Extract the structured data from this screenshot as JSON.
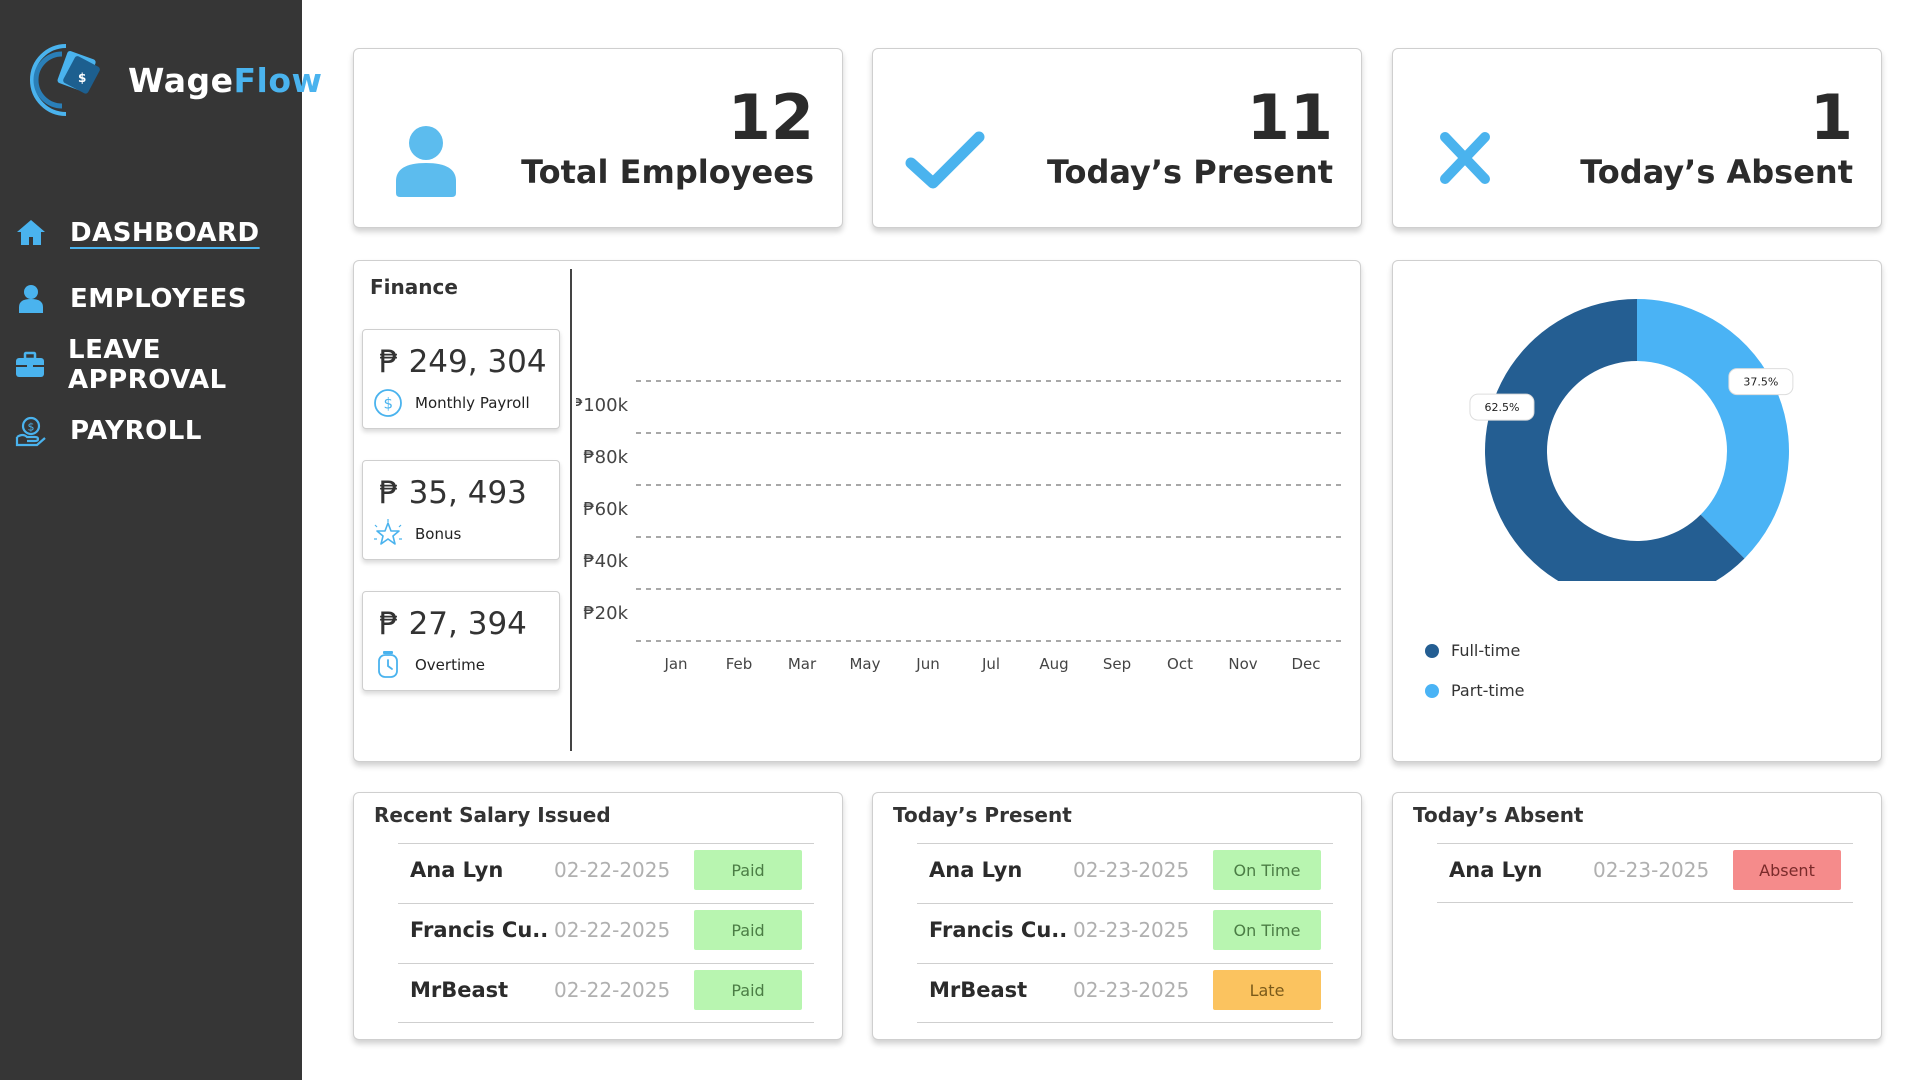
{
  "app": {
    "brand_prefix": "Wage",
    "brand_suffix": "Flow"
  },
  "sidebar": {
    "items": [
      {
        "label": "DASHBOARD",
        "icon": "home-icon",
        "active": true
      },
      {
        "label": "EMPLOYEES",
        "icon": "user-icon",
        "active": false
      },
      {
        "label": "LEAVE APPROVAL",
        "icon": "briefcase-icon",
        "active": false
      },
      {
        "label": "PAYROLL",
        "icon": "payroll-hand-icon",
        "active": false
      }
    ]
  },
  "stats": [
    {
      "value": "12",
      "label": "Total Employees",
      "icon": "user-icon"
    },
    {
      "value": "11",
      "label": "Today’s Present",
      "icon": "check-icon"
    },
    {
      "value": "1",
      "label": "Today’s Absent",
      "icon": "x-icon"
    }
  ],
  "finance": {
    "title": "Finance",
    "cards": [
      {
        "amount": "₱ 249, 304",
        "label": "Monthly Payroll",
        "icon": "dollar-circle-icon"
      },
      {
        "amount": "₱ 35, 493",
        "label": "Bonus",
        "icon": "star-icon"
      },
      {
        "amount": "₱ 27, 394",
        "label": "Overtime",
        "icon": "stopwatch-icon"
      }
    ]
  },
  "chart_data": [
    {
      "type": "line",
      "title": "",
      "xlabel": "",
      "ylabel": "",
      "categories": [
        "Jan",
        "Feb",
        "Mar",
        "May",
        "Jun",
        "Jul",
        "Aug",
        "Sep",
        "Oct",
        "Nov",
        "Dec"
      ],
      "y_ticks": [
        "₱100k",
        "₱80k",
        "₱60k",
        "₱40k",
        "₱20k"
      ],
      "series": [],
      "grid": true
    },
    {
      "type": "pie",
      "variant": "donut",
      "slices": [
        {
          "name": "Full-time",
          "value": 62.5,
          "label": "62.5%",
          "color": "#245e92"
        },
        {
          "name": "Part-time",
          "value": 37.5,
          "label": "37.5%",
          "color": "#4ab3f5"
        }
      ],
      "legend": "bottom-left"
    }
  ],
  "tables": [
    {
      "title": "Recent Salary Issued",
      "rows": [
        {
          "name": "Ana Lyn",
          "date": "02-22-2025",
          "status": "Paid",
          "status_color": "#b8f5b0",
          "text_color": "#4b7d45"
        },
        {
          "name": "Francis Cu..",
          "date": "02-22-2025",
          "status": "Paid",
          "status_color": "#b8f5b0",
          "text_color": "#4b7d45"
        },
        {
          "name": "MrBeast",
          "date": "02-22-2025",
          "status": "Paid",
          "status_color": "#b8f5b0",
          "text_color": "#4b7d45"
        }
      ]
    },
    {
      "title": "Today’s Present",
      "rows": [
        {
          "name": "Ana Lyn",
          "date": "02-23-2025",
          "status": "On Time",
          "status_color": "#b8f5b0",
          "text_color": "#4b7d45"
        },
        {
          "name": "Francis Cu..",
          "date": "02-23-2025",
          "status": "On Time",
          "status_color": "#b8f5b0",
          "text_color": "#4b7d45"
        },
        {
          "name": "MrBeast",
          "date": "02-23-2025",
          "status": "Late",
          "status_color": "#fbc35f",
          "text_color": "#7a5a1a"
        }
      ]
    },
    {
      "title": "Today’s Absent",
      "rows": [
        {
          "name": "Ana Lyn",
          "date": "02-23-2025",
          "status": "Absent",
          "status_color": "#f58b8b",
          "text_color": "#7a2a2a"
        }
      ]
    }
  ],
  "colors": {
    "sidebar_bg": "#363636",
    "accent": "#4ab3ee",
    "full_time": "#245e92",
    "part_time": "#4ab3f5"
  }
}
